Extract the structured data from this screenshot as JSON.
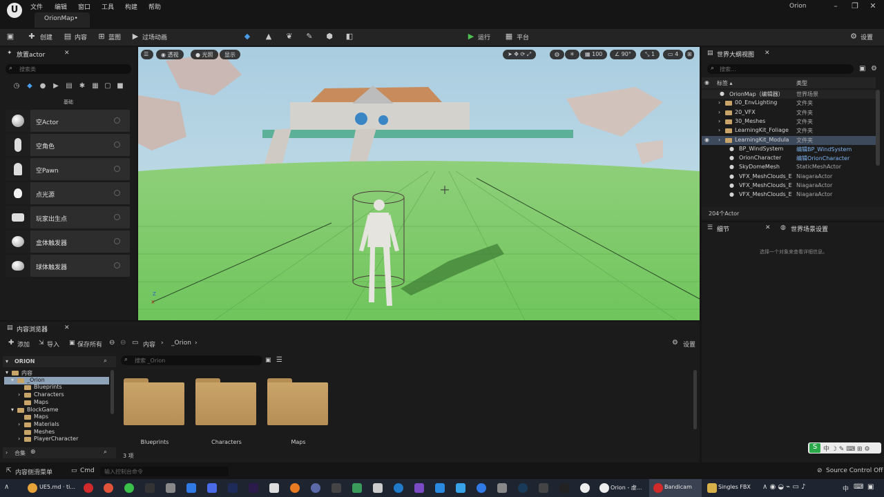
{
  "menu": {
    "items": [
      "文件",
      "编辑",
      "窗口",
      "工具",
      "构建",
      "帮助"
    ],
    "map_tab": "OrionMap•",
    "user": "Orion"
  },
  "window_controls": {
    "minimize": "–",
    "maximize": "❐",
    "close": "✕"
  },
  "toolbar": {
    "create": "创建",
    "content": "内容",
    "blueprint": "蓝图",
    "cinematics": "过场动画",
    "play": "运行",
    "platform": "平台",
    "settings": "设置"
  },
  "place_actors": {
    "tab_label": "放置actor",
    "search_placeholder": "搜索类",
    "category_label": "基础",
    "items": [
      {
        "label": "空Actor",
        "icon": "sphere-icon"
      },
      {
        "label": "空角色",
        "icon": "character-icon"
      },
      {
        "label": "空Pawn",
        "icon": "pawn-icon"
      },
      {
        "label": "点光源",
        "icon": "light-bulb-icon"
      },
      {
        "label": "玩家出生点",
        "icon": "player-start-icon"
      },
      {
        "label": "盒体触发器",
        "icon": "box-trigger-icon"
      },
      {
        "label": "球体触发器",
        "icon": "sphere-trigger-icon"
      }
    ]
  },
  "viewport": {
    "perspective": "透视",
    "lighting": "光照",
    "show": "显示",
    "grid_size": "100",
    "angle": "90°",
    "scale": "1",
    "camera_speed": "4",
    "axis_z": "Z",
    "axis_x": "X"
  },
  "outliner": {
    "tab_label": "世界大纲视图",
    "search_placeholder": "搜索...",
    "col_label": "标签 ▴",
    "col_type": "类型",
    "rows": [
      {
        "name": "OrionMap（编辑器）",
        "type": "世界场景",
        "link": false
      },
      {
        "name": "00_EnvLighting",
        "type": "文件夹",
        "link": false
      },
      {
        "name": "20_VFX",
        "type": "文件夹",
        "link": false
      },
      {
        "name": "30_Meshes",
        "type": "文件夹",
        "link": false
      },
      {
        "name": "LearningKit_Foliage",
        "type": "文件夹",
        "link": false
      },
      {
        "name": "LearningKit_Modula",
        "type": "文件夹",
        "link": false
      },
      {
        "name": "BP_WindSystem",
        "type": "编辑BP_WindSystem",
        "link": true
      },
      {
        "name": "OrionCharacter",
        "type": "编辑OrionCharacter",
        "link": true
      },
      {
        "name": "SkyDomeMesh",
        "type": "StaticMeshActor",
        "link": false
      },
      {
        "name": "VFX_MeshClouds_E",
        "type": "NiagaraActor",
        "link": false
      },
      {
        "name": "VFX_MeshClouds_E",
        "type": "NiagaraActor",
        "link": false
      },
      {
        "name": "VFX_MeshClouds_E",
        "type": "NiagaraActor",
        "link": false
      }
    ],
    "count": "204个Actor"
  },
  "details": {
    "tab_label": "细节",
    "world_settings": "世界场景设置",
    "empty_hint": "选择一个对象来查看详细信息。"
  },
  "content_browser": {
    "tab_label": "内容浏览器",
    "add": "添加",
    "import": "导入",
    "save_all": "保存所有",
    "path_root": "内容",
    "path_current": "_Orion",
    "settings": "设置",
    "tree_root": "ORION",
    "search_placeholder": "搜索 _Orion",
    "tree": [
      "内容",
      "_Orion",
      "Blueprints",
      "Characters",
      "Maps",
      "BlockGame",
      "Maps",
      "Materials",
      "Meshes",
      "PlayerCharacter"
    ],
    "collections": "合集",
    "folders": [
      "Blueprints",
      "Characters",
      "Maps"
    ],
    "item_count": "3 项"
  },
  "statusbar": {
    "drawer": "内容侧滑菜单",
    "cmd": "Cmd",
    "console_placeholder": "输入控制台命令",
    "source_control": "Source Control Off"
  },
  "taskbar": {
    "chrome_label": "UE5.md · ti...",
    "unreal_label": "Orion - 虚...",
    "bandicam_label": "Bandicam",
    "singles_label": "Singles FBX",
    "ime": "中"
  }
}
